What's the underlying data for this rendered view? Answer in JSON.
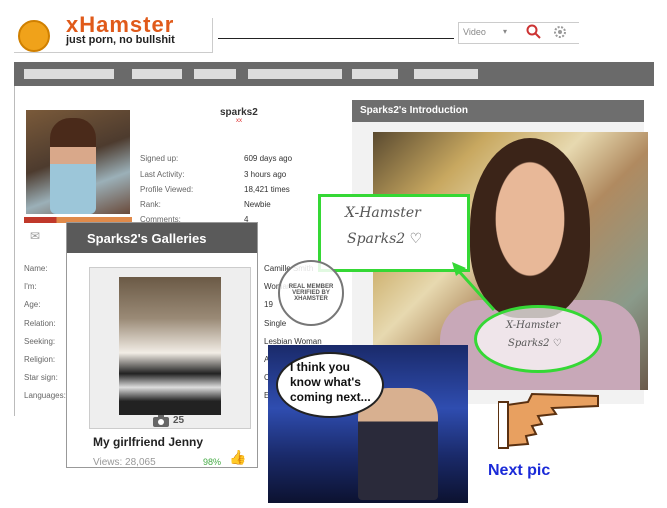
{
  "header": {
    "brand": "xHamster",
    "tagline": "just porn, no bullshit",
    "search_category": "Video",
    "search_icon": "search-icon",
    "settings_icon": "gear-icon"
  },
  "nav": {
    "items": [
      "",
      "",
      "",
      "",
      "",
      "",
      "",
      ""
    ]
  },
  "profile": {
    "username": "sparks2",
    "gender_mark": "xx",
    "stats": [
      {
        "label": "Signed up:",
        "value": "609 days ago"
      },
      {
        "label": "Last Activity:",
        "value": "3 hours ago"
      },
      {
        "label": "Profile Viewed:",
        "value": "18,421 times"
      },
      {
        "label": "Rank:",
        "value": "Newbie"
      },
      {
        "label": "Comments:",
        "value": "4"
      }
    ],
    "details": [
      {
        "label": "Name:",
        "value": "Camille Smith"
      },
      {
        "label": "I'm:",
        "value": "Woman"
      },
      {
        "label": "Age:",
        "value": "19"
      },
      {
        "label": "Relation:",
        "value": "Single"
      },
      {
        "label": "Seeking:",
        "value": "Lesbian Woman"
      },
      {
        "label": "Religion:",
        "value": "A"
      },
      {
        "label": "Star sign:",
        "value": "C"
      },
      {
        "label": "Languages:",
        "value": "E"
      }
    ]
  },
  "intro": {
    "title": "Sparks2's Introduction"
  },
  "gallery": {
    "title": "Sparks2's Galleries",
    "photo_count": "25",
    "name": "My girlfriend Jenny",
    "views": "Views: 28,065",
    "rating": "98%"
  },
  "stamp": {
    "text": "REAL MEMBER VERIFIED BY XHAMSTER"
  },
  "annotation": {
    "note_line1": "X-Hamster",
    "note_line2": "Sparks2 ♡",
    "bubble": "I think you know what's coming next...",
    "next": "Next pic"
  },
  "colors": {
    "nav_bg": "#6a6a6a",
    "panel_head": "#6e6e6e",
    "highlight_green": "#35d835",
    "next_blue": "#1a2ad8",
    "brand_orange": "#e05a1a"
  }
}
